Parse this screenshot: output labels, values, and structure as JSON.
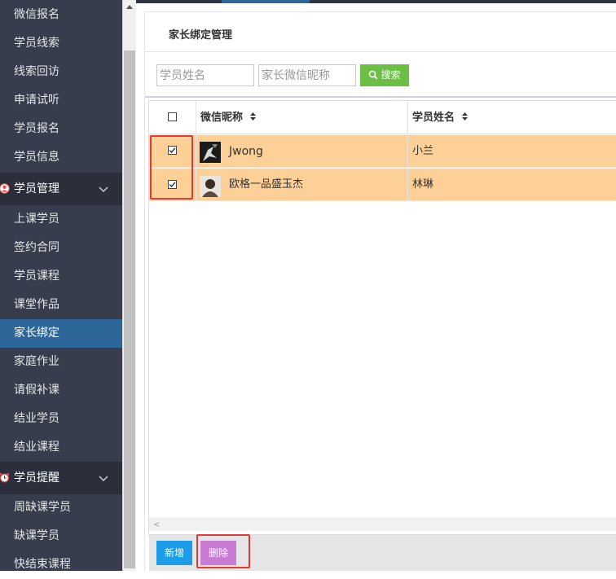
{
  "sidebar": {
    "items_top": [
      "微信报名",
      "学员线索",
      "线索回访",
      "申请试听",
      "学员报名",
      "学员信息"
    ],
    "group_student": {
      "label": "学员管理",
      "icon": "user-icon"
    },
    "items_student": [
      "上课学员",
      "签约合同",
      "学员课程",
      "课堂作品",
      "家长绑定",
      "家庭作业",
      "请假补课",
      "结业学员",
      "结业课程"
    ],
    "active_item": "家长绑定",
    "group_remind": {
      "label": "学员提醒",
      "icon": "alarm-clock-icon"
    },
    "items_remind": [
      "周缺课学员",
      "缺课学员",
      "快结束课程"
    ]
  },
  "main": {
    "title": "家长绑定管理",
    "search": {
      "student_name_placeholder": "学员姓名",
      "wechat_nick_placeholder": "家长微信昵称",
      "button_label": "搜索",
      "button_icon": "search-icon"
    },
    "table": {
      "columns": [
        "微信昵称",
        "学员姓名"
      ],
      "rows": [
        {
          "checked": true,
          "nickname": "Jwong",
          "student": "小兰"
        },
        {
          "checked": true,
          "nickname": "欧格一品盛玉杰",
          "student": "林琳"
        }
      ],
      "selected_row_color": "#fdd098"
    },
    "footer": {
      "add_label": "新增",
      "delete_label": "删除"
    }
  },
  "colors": {
    "sidebar_bg": "#373d4c",
    "sidebar_active": "#2d6799",
    "search_button": "#6bbf45",
    "add_button": "#1d9ce9",
    "delete_button": "#c97bd4",
    "highlight_box": "#e53935"
  }
}
